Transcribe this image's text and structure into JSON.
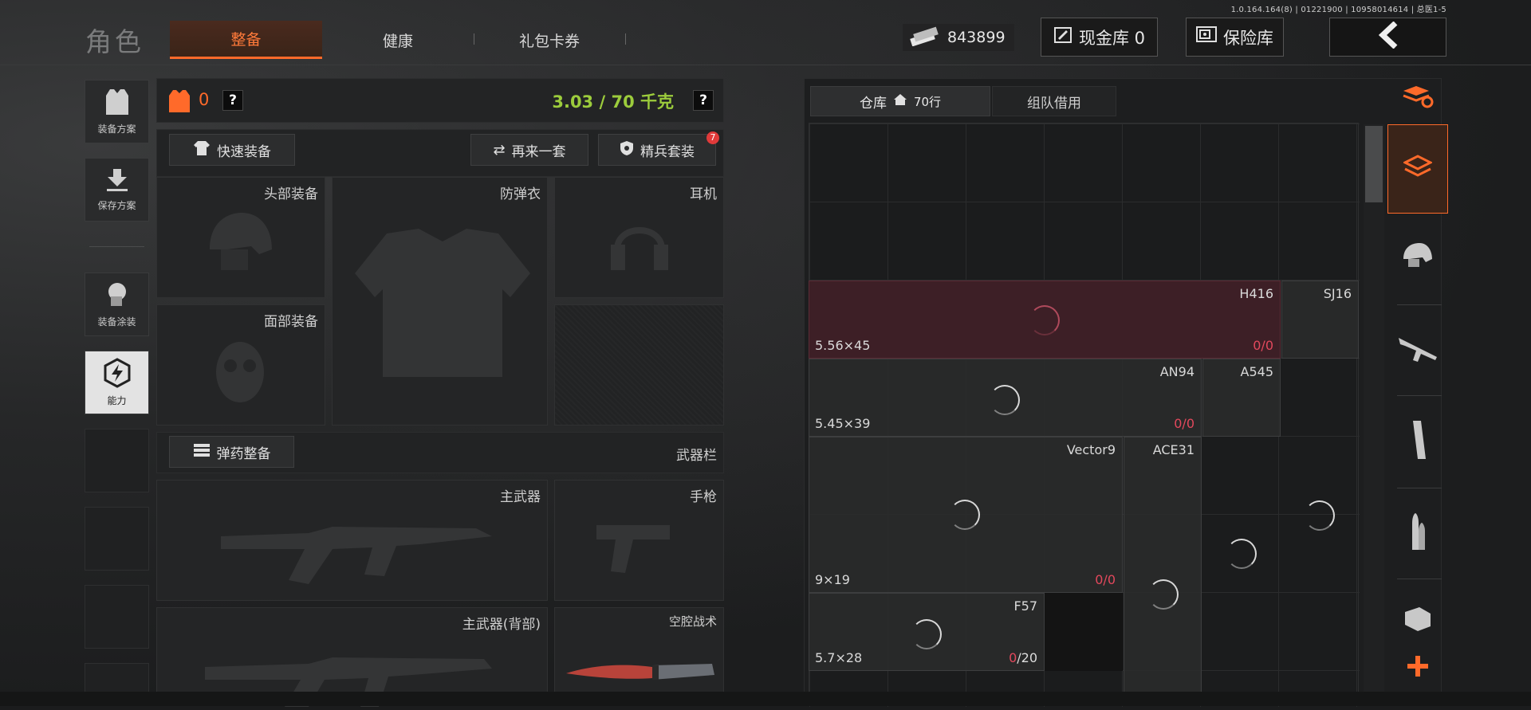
{
  "version": "1.0.164.164(8) | 01221900 | 10958014614 | 总医1-5",
  "title": "角色",
  "tabs": [
    {
      "label": "整备",
      "active": true
    },
    {
      "label": "健康",
      "active": false
    },
    {
      "label": "礼包卡券",
      "active": false
    }
  ],
  "header": {
    "cash": "843899",
    "cash_vault": "现金库 0",
    "safe": "保险库"
  },
  "sidebar": {
    "equip_plan": "装备方案",
    "save_plan": "保存方案",
    "equip_skin": "装备涂装",
    "ability": "能力"
  },
  "loadout": {
    "armor_count": "0",
    "help": "?",
    "weight": "3.03 / 70 千克",
    "quick_equip": "快速装备",
    "retry": "再来一套",
    "elite": "精兵套装",
    "elite_badge": "7",
    "slots": {
      "head": "头部装备",
      "vest": "防弹衣",
      "headset": "耳机",
      "face": "面部装备"
    },
    "ammo_btn": "弹药整备",
    "weapon_bar": "武器栏",
    "primary": "主武器",
    "pistol": "手枪",
    "primary_back": "主武器(背部)",
    "melee": "空腔战术"
  },
  "stash": {
    "tab_warehouse": "仓库",
    "tab_rows": "70行",
    "tab_team": "组队借用",
    "items": [
      {
        "name": "H416",
        "caliber": "5.56×45",
        "count_red": "0",
        "count_rest": "/0"
      },
      {
        "name": "SJ16"
      },
      {
        "name": "AN94",
        "caliber": "5.45×39",
        "count_red": "0",
        "count_rest": "/0"
      },
      {
        "name": "A545"
      },
      {
        "name": "Vector9",
        "caliber": "9×19",
        "count_red": "0",
        "count_rest": "/0"
      },
      {
        "name": "ACE31"
      },
      {
        "name": "F57",
        "caliber": "5.7×28",
        "count_red": "0",
        "count_rest": "/20"
      }
    ]
  },
  "colors": {
    "accent": "#ff6a2a",
    "red": "#e2485c",
    "weight_green": "#9ccc3c"
  }
}
